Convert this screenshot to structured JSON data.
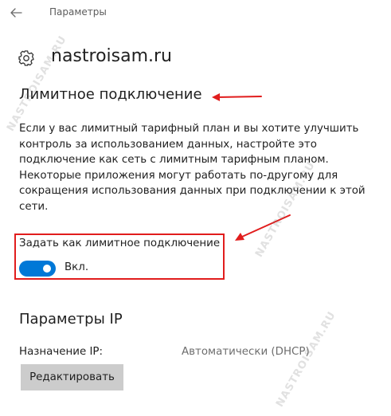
{
  "titlebar": {
    "back_icon": "arrow-left-icon",
    "title": "Параметры"
  },
  "header": {
    "icon": "gear-icon",
    "title": "nastroisam.ru"
  },
  "metered": {
    "heading": "Лимитное подключение",
    "description_lines": [
      "Если у вас лимитный тарифный план и вы хотите улучшить",
      "контроль за использованием данных, настройте это",
      "подключение как сеть с лимитным тарифным планом.",
      "Некоторые приложения могут работать по-другому для",
      "сокращения использования данных при подключении к этой",
      "сети."
    ],
    "toggle": {
      "label": "Задать как лимитное подключение",
      "state_text": "Вкл.",
      "on": true
    }
  },
  "ip_settings": {
    "heading": "Параметры IP",
    "assignment_label": "Назначение IP:",
    "assignment_value": "Автоматически (DHCP)",
    "edit_button": "Редактировать"
  },
  "watermarks": [
    "NASTROISAM.RU",
    "NASTROISAM.RU",
    "NASTROISAM.RU"
  ],
  "colors": {
    "accent": "#0078d7",
    "annotation": "#e11d1d",
    "button_bg": "#cccccc"
  }
}
